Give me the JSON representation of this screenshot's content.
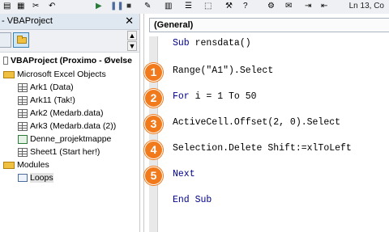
{
  "toolbar": {
    "cursor_position": "Ln 13, Co"
  },
  "project_pane": {
    "title": "- VBAProject",
    "tree": [
      {
        "label": "VBAProject (Proximo - Øvelse",
        "icon": "project-icon",
        "bold": true
      },
      {
        "label": "Microsoft Excel Objects",
        "icon": "folder-icon"
      },
      {
        "label": "Ark1 (Data)",
        "icon": "sheet-icon"
      },
      {
        "label": "Ark11 (Tak!)",
        "icon": "sheet-icon"
      },
      {
        "label": "Ark2 (Medarb.data)",
        "icon": "sheet-icon"
      },
      {
        "label": "Ark3 (Medarb.data (2))",
        "icon": "sheet-icon"
      },
      {
        "label": "Denne_projektmappe",
        "icon": "workbook-icon"
      },
      {
        "label": "Sheet1 (Start her!)",
        "icon": "sheet-icon"
      },
      {
        "label": "Modules",
        "icon": "folder-icon"
      },
      {
        "label": "Loops",
        "icon": "module-icon"
      }
    ]
  },
  "editor": {
    "object_dropdown": "(General)",
    "lines": [
      {
        "kw": "Sub",
        "rest": " rensdata()"
      },
      {
        "kw": "",
        "rest": "Range(\"A1\").Select"
      },
      {
        "kw": "For",
        "rest": " i = 1 To 50"
      },
      {
        "kw": "",
        "rest": "ActiveCell.Offset(2, 0).Select"
      },
      {
        "kw": "",
        "rest": "Selection.Delete Shift:=xlToLeft"
      },
      {
        "kw": "Next",
        "rest": ""
      },
      {
        "kw": "End Sub",
        "rest": ""
      }
    ],
    "badges": [
      "1",
      "2",
      "3",
      "4",
      "5"
    ]
  },
  "colors": {
    "badge": "#f07a1c",
    "keyword": "#00008b",
    "title_bar": "#dfe7f1"
  }
}
